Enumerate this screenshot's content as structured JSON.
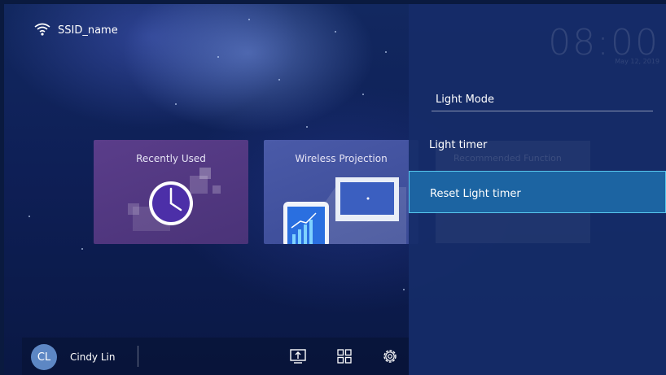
{
  "status": {
    "ssid": "SSID_name",
    "wifi_icon": "wifi-icon"
  },
  "clock": {
    "time": "08:00",
    "date": "May 12, 2019"
  },
  "tiles": [
    {
      "title": "Recently Used",
      "icon": "clock-icon"
    },
    {
      "title": "Wireless Projection",
      "icon": "phone-screen-icon"
    }
  ],
  "panel": {
    "background_hint": "Recommended Function",
    "items": [
      {
        "label": "Light Mode"
      },
      {
        "label": "Light timer"
      },
      {
        "label": "Reset Light timer",
        "selected": true
      }
    ]
  },
  "bottom_bar": {
    "avatar_initials": "CL",
    "user_name": "Cindy Lin",
    "icons": [
      "input-source-icon",
      "apps-grid-icon",
      "settings-gear-icon"
    ]
  },
  "colors": {
    "selected_bg": "#1c64a2",
    "selected_border": "#58c8ee",
    "panel_bg": "#152c68",
    "avatar_bg": "#5d87c4"
  }
}
